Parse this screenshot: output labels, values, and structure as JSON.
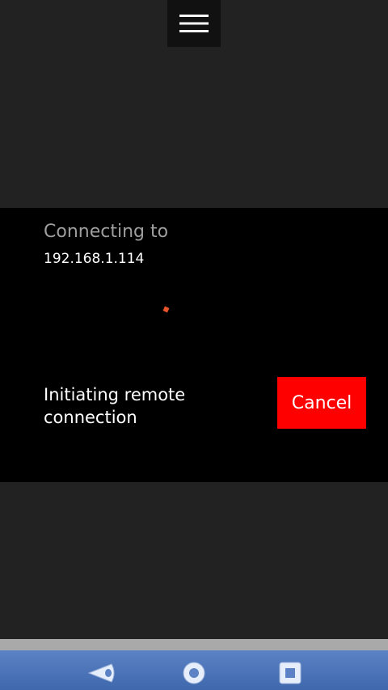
{
  "header": {
    "menu_icon": "hamburger-menu-icon"
  },
  "dialog": {
    "label": "Connecting to",
    "host": "192.168.1.114",
    "status": "Initiating remote connection",
    "cancel_label": "Cancel",
    "spinner_icon": "loading-spinner-icon"
  },
  "colors": {
    "background": "#222222",
    "dialog_background": "#000000",
    "accent": "#ff0000",
    "spinner": "#e8542a",
    "nav_bar": "#4a73b8"
  },
  "nav": {
    "icons": [
      "back-icon",
      "home-icon",
      "recent-apps-icon"
    ]
  }
}
